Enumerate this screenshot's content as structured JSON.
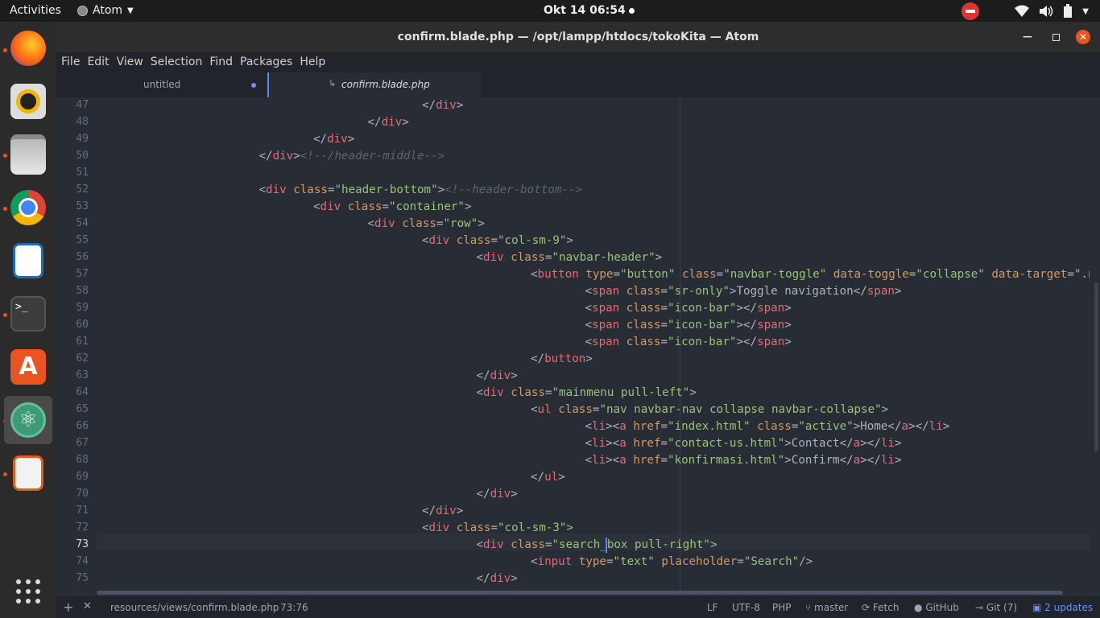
{
  "topbar": {
    "activities": "Activities",
    "app_name": "Atom",
    "clock": "Okt 14  06:54"
  },
  "dock": {
    "apps": [
      "firefox-icon",
      "rhythmbox-icon",
      "files-icon",
      "chrome-icon",
      "libreoffice-impress-icon",
      "terminal-icon",
      "software-center-icon",
      "atom-icon",
      "libreoffice-writer-icon"
    ],
    "grid_icon": "show-applications-icon"
  },
  "window": {
    "title": "confirm.blade.php — /opt/lampp/htdocs/tokoKita — Atom",
    "menu": [
      "File",
      "Edit",
      "View",
      "Selection",
      "Find",
      "Packages",
      "Help"
    ],
    "tabs": [
      {
        "label": "untitled",
        "modified": true
      },
      {
        "label": "confirm.blade.php",
        "active": true
      }
    ]
  },
  "editor": {
    "cursor_line": 73,
    "lines": [
      {
        "n": "47",
        "indent": 6,
        "tokens": [
          [
            "p",
            "</"
          ],
          [
            "t",
            "div"
          ],
          [
            "p",
            ">"
          ]
        ]
      },
      {
        "n": "48",
        "indent": 5,
        "tokens": [
          [
            "p",
            "</"
          ],
          [
            "t",
            "div"
          ],
          [
            "p",
            ">"
          ]
        ]
      },
      {
        "n": "49",
        "indent": 4,
        "tokens": [
          [
            "p",
            "</"
          ],
          [
            "t",
            "div"
          ],
          [
            "p",
            ">"
          ]
        ]
      },
      {
        "n": "50",
        "indent": 3,
        "tokens": [
          [
            "p",
            "</"
          ],
          [
            "t",
            "div"
          ],
          [
            "p",
            ">"
          ],
          [
            "c",
            "<!--/header-middle-->"
          ]
        ]
      },
      {
        "n": "51",
        "indent": 0,
        "tokens": []
      },
      {
        "n": "52",
        "indent": 3,
        "tokens": [
          [
            "p",
            "<"
          ],
          [
            "t",
            "div"
          ],
          [
            "p",
            " "
          ],
          [
            "a",
            "class"
          ],
          [
            "p",
            "="
          ],
          [
            "s",
            "\"header-bottom\""
          ],
          [
            "p",
            ">"
          ],
          [
            "c",
            "<!--header-bottom-->"
          ]
        ]
      },
      {
        "n": "53",
        "indent": 4,
        "tokens": [
          [
            "p",
            "<"
          ],
          [
            "t",
            "div"
          ],
          [
            "p",
            " "
          ],
          [
            "a",
            "class"
          ],
          [
            "p",
            "="
          ],
          [
            "s",
            "\"container\""
          ],
          [
            "p",
            ">"
          ]
        ]
      },
      {
        "n": "54",
        "indent": 5,
        "tokens": [
          [
            "p",
            "<"
          ],
          [
            "t",
            "div"
          ],
          [
            "p",
            " "
          ],
          [
            "a",
            "class"
          ],
          [
            "p",
            "="
          ],
          [
            "s",
            "\"row\""
          ],
          [
            "p",
            ">"
          ]
        ]
      },
      {
        "n": "55",
        "indent": 6,
        "tokens": [
          [
            "p",
            "<"
          ],
          [
            "t",
            "div"
          ],
          [
            "p",
            " "
          ],
          [
            "a",
            "class"
          ],
          [
            "p",
            "="
          ],
          [
            "s",
            "\"col-sm-9\""
          ],
          [
            "p",
            ">"
          ]
        ]
      },
      {
        "n": "56",
        "indent": 7,
        "tokens": [
          [
            "p",
            "<"
          ],
          [
            "t",
            "div"
          ],
          [
            "p",
            " "
          ],
          [
            "a",
            "class"
          ],
          [
            "p",
            "="
          ],
          [
            "s",
            "\"navbar-header\""
          ],
          [
            "p",
            ">"
          ]
        ]
      },
      {
        "n": "57",
        "indent": 8,
        "tokens": [
          [
            "p",
            "<"
          ],
          [
            "t",
            "button"
          ],
          [
            "p",
            " "
          ],
          [
            "a",
            "type"
          ],
          [
            "p",
            "="
          ],
          [
            "s",
            "\"button\""
          ],
          [
            "p",
            " "
          ],
          [
            "a",
            "class"
          ],
          [
            "p",
            "="
          ],
          [
            "s",
            "\"navbar-toggle\""
          ],
          [
            "p",
            " "
          ],
          [
            "a",
            "data-toggle"
          ],
          [
            "p",
            "="
          ],
          [
            "s",
            "\"collapse\""
          ],
          [
            "p",
            " "
          ],
          [
            "a",
            "data-target"
          ],
          [
            "p",
            "="
          ],
          [
            "s",
            "\".navbar-collapse\""
          ],
          [
            "p",
            ">"
          ]
        ]
      },
      {
        "n": "58",
        "indent": 9,
        "tokens": [
          [
            "p",
            "<"
          ],
          [
            "t",
            "span"
          ],
          [
            "p",
            " "
          ],
          [
            "a",
            "class"
          ],
          [
            "p",
            "="
          ],
          [
            "s",
            "\"sr-only\""
          ],
          [
            "p",
            ">Toggle navigation</"
          ],
          [
            "t",
            "span"
          ],
          [
            "p",
            ">"
          ]
        ]
      },
      {
        "n": "59",
        "indent": 9,
        "tokens": [
          [
            "p",
            "<"
          ],
          [
            "t",
            "span"
          ],
          [
            "p",
            " "
          ],
          [
            "a",
            "class"
          ],
          [
            "p",
            "="
          ],
          [
            "s",
            "\"icon-bar\""
          ],
          [
            "p",
            "></"
          ],
          [
            "t",
            "span"
          ],
          [
            "p",
            ">"
          ]
        ]
      },
      {
        "n": "60",
        "indent": 9,
        "tokens": [
          [
            "p",
            "<"
          ],
          [
            "t",
            "span"
          ],
          [
            "p",
            " "
          ],
          [
            "a",
            "class"
          ],
          [
            "p",
            "="
          ],
          [
            "s",
            "\"icon-bar\""
          ],
          [
            "p",
            "></"
          ],
          [
            "t",
            "span"
          ],
          [
            "p",
            ">"
          ]
        ]
      },
      {
        "n": "61",
        "indent": 9,
        "tokens": [
          [
            "p",
            "<"
          ],
          [
            "t",
            "span"
          ],
          [
            "p",
            " "
          ],
          [
            "a",
            "class"
          ],
          [
            "p",
            "="
          ],
          [
            "s",
            "\"icon-bar\""
          ],
          [
            "p",
            "></"
          ],
          [
            "t",
            "span"
          ],
          [
            "p",
            ">"
          ]
        ]
      },
      {
        "n": "62",
        "indent": 8,
        "tokens": [
          [
            "p",
            "</"
          ],
          [
            "t",
            "button"
          ],
          [
            "p",
            ">"
          ]
        ]
      },
      {
        "n": "63",
        "indent": 7,
        "tokens": [
          [
            "p",
            "</"
          ],
          [
            "t",
            "div"
          ],
          [
            "p",
            ">"
          ]
        ]
      },
      {
        "n": "64",
        "indent": 7,
        "tokens": [
          [
            "p",
            "<"
          ],
          [
            "t",
            "div"
          ],
          [
            "p",
            " "
          ],
          [
            "a",
            "class"
          ],
          [
            "p",
            "="
          ],
          [
            "s",
            "\"mainmenu pull-left\""
          ],
          [
            "p",
            ">"
          ]
        ]
      },
      {
        "n": "65",
        "indent": 8,
        "tokens": [
          [
            "p",
            "<"
          ],
          [
            "t",
            "ul"
          ],
          [
            "p",
            " "
          ],
          [
            "a",
            "class"
          ],
          [
            "p",
            "="
          ],
          [
            "s",
            "\"nav navbar-nav collapse navbar-collapse\""
          ],
          [
            "p",
            ">"
          ]
        ]
      },
      {
        "n": "66",
        "indent": 9,
        "tokens": [
          [
            "p",
            "<"
          ],
          [
            "t",
            "li"
          ],
          [
            "p",
            "><"
          ],
          [
            "t",
            "a"
          ],
          [
            "p",
            " "
          ],
          [
            "a",
            "href"
          ],
          [
            "p",
            "="
          ],
          [
            "s",
            "\"index.html\""
          ],
          [
            "p",
            " "
          ],
          [
            "a",
            "class"
          ],
          [
            "p",
            "="
          ],
          [
            "s",
            "\"active\""
          ],
          [
            "p",
            ">Home</"
          ],
          [
            "t",
            "a"
          ],
          [
            "p",
            "></"
          ],
          [
            "t",
            "li"
          ],
          [
            "p",
            ">"
          ]
        ]
      },
      {
        "n": "67",
        "indent": 9,
        "tokens": [
          [
            "p",
            "<"
          ],
          [
            "t",
            "li"
          ],
          [
            "p",
            "><"
          ],
          [
            "t",
            "a"
          ],
          [
            "p",
            " "
          ],
          [
            "a",
            "href"
          ],
          [
            "p",
            "="
          ],
          [
            "s",
            "\"contact-us.html\""
          ],
          [
            "p",
            ">Contact</"
          ],
          [
            "t",
            "a"
          ],
          [
            "p",
            "></"
          ],
          [
            "t",
            "li"
          ],
          [
            "p",
            ">"
          ]
        ]
      },
      {
        "n": "68",
        "indent": 9,
        "tokens": [
          [
            "p",
            "<"
          ],
          [
            "t",
            "li"
          ],
          [
            "p",
            "><"
          ],
          [
            "t",
            "a"
          ],
          [
            "p",
            " "
          ],
          [
            "a",
            "href"
          ],
          [
            "p",
            "="
          ],
          [
            "s",
            "\"konfirmasi.html\""
          ],
          [
            "p",
            ">Confirm</"
          ],
          [
            "t",
            "a"
          ],
          [
            "p",
            "></"
          ],
          [
            "t",
            "li"
          ],
          [
            "p",
            ">"
          ]
        ]
      },
      {
        "n": "69",
        "indent": 8,
        "tokens": [
          [
            "p",
            "</"
          ],
          [
            "t",
            "ul"
          ],
          [
            "p",
            ">"
          ]
        ]
      },
      {
        "n": "70",
        "indent": 7,
        "tokens": [
          [
            "p",
            "</"
          ],
          [
            "t",
            "div"
          ],
          [
            "p",
            ">"
          ]
        ]
      },
      {
        "n": "71",
        "indent": 6,
        "tokens": [
          [
            "p",
            "</"
          ],
          [
            "t",
            "div"
          ],
          [
            "p",
            ">"
          ]
        ]
      },
      {
        "n": "72",
        "indent": 6,
        "tokens": [
          [
            "p",
            "<"
          ],
          [
            "t",
            "div"
          ],
          [
            "p",
            " "
          ],
          [
            "a",
            "class"
          ],
          [
            "p",
            "="
          ],
          [
            "s",
            "\"col-sm-3\""
          ],
          [
            "p",
            ">"
          ]
        ]
      },
      {
        "n": "73",
        "indent": 7,
        "tokens": [
          [
            "p",
            "<"
          ],
          [
            "t",
            "div"
          ],
          [
            "p",
            " "
          ],
          [
            "a",
            "class"
          ],
          [
            "p",
            "="
          ],
          [
            "s",
            "\"search_box pull-right\""
          ],
          [
            "p",
            ">"
          ]
        ]
      },
      {
        "n": "74",
        "indent": 8,
        "tokens": [
          [
            "p",
            "<"
          ],
          [
            "t",
            "input"
          ],
          [
            "p",
            " "
          ],
          [
            "a",
            "type"
          ],
          [
            "p",
            "="
          ],
          [
            "s",
            "\"text\""
          ],
          [
            "p",
            " "
          ],
          [
            "a",
            "placeholder"
          ],
          [
            "p",
            "="
          ],
          [
            "s",
            "\"Search\""
          ],
          [
            "p",
            "/>"
          ]
        ]
      },
      {
        "n": "75",
        "indent": 7,
        "tokens": [
          [
            "p",
            "</"
          ],
          [
            "t",
            "div"
          ],
          [
            "p",
            ">"
          ]
        ]
      }
    ]
  },
  "statusbar": {
    "add_label": "+",
    "close_label": "✕",
    "file_path": "resources/views/confirm.blade.php",
    "cursor_pos": "73:76",
    "line_ending": "LF",
    "encoding": "UTF-8",
    "grammar": "PHP",
    "branch": "master",
    "fetch": "Fetch",
    "github": "GitHub",
    "git": "Git (7)",
    "updates": "2 updates"
  }
}
